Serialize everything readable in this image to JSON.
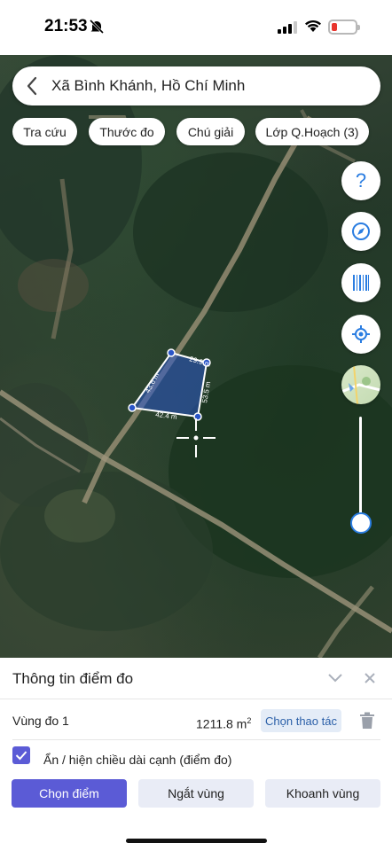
{
  "status": {
    "time": "21:53"
  },
  "search": {
    "text": "Xã Bình Khánh, Hồ Chí Minh"
  },
  "chips": [
    {
      "label": "Tra cứu"
    },
    {
      "label": "Thước đo"
    },
    {
      "label": "Chú giải"
    },
    {
      "label": "Lớp Q.Hoạch (3)"
    }
  ],
  "measurements": {
    "top": "29.9 m",
    "left": "43.6 m",
    "right": "53.5 m",
    "bottom": "42.4 m"
  },
  "tools": {
    "help": "?",
    "polygon_color": "#2a55c8"
  },
  "zoom_level": 0.9,
  "panel": {
    "title": "Thông tin điểm đo",
    "zone_name": "Vùng đo 1",
    "area_value": "1211.8 m",
    "area_unit_sup": "2",
    "choose_action": "Chọn thao tác",
    "toggle_label": "Ẩn / hiện chiều dài cạnh (điểm đo)",
    "toggle_checked": true,
    "btn_choose_point": "Chọn điểm",
    "btn_break_zone": "Ngắt vùng",
    "btn_enclose_zone": "Khoanh vùng"
  },
  "colors": {
    "accent": "#5b5bd6",
    "link": "#2a5fa8"
  }
}
